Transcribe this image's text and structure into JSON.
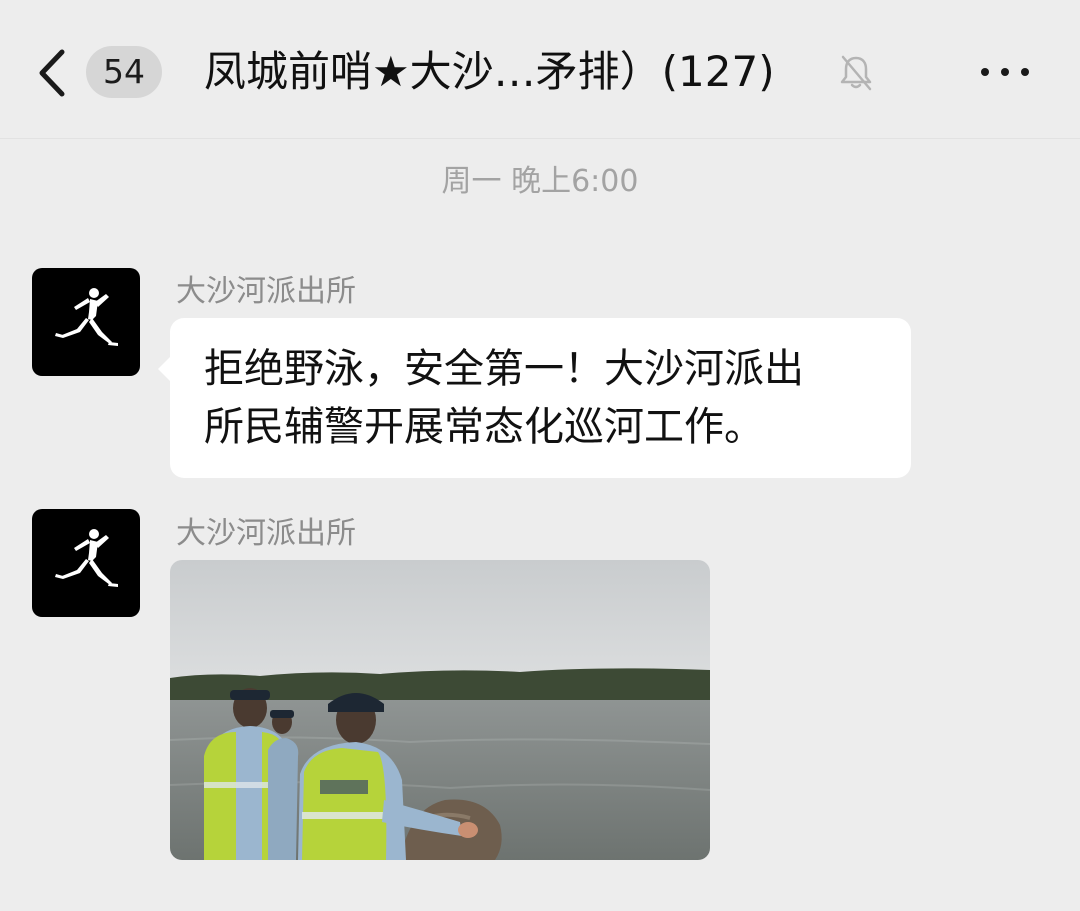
{
  "header": {
    "back_icon": "chevron-left-icon",
    "unread_count": "54",
    "title": "凤城前哨★大沙…矛排）(127)",
    "mute_icon": "bell-muted-icon",
    "more_icon": "ellipsis-icon"
  },
  "timestamp": "周一 晚上6:00",
  "messages": [
    {
      "type": "text",
      "sender": "大沙河派出所",
      "avatar_icon": "jumpman-logo-icon",
      "line1": "拒绝野泳，安全第一！大沙河派出",
      "line2": "所民辅警开展常态化巡河工作。"
    },
    {
      "type": "image",
      "sender": "大沙河派出所",
      "avatar_icon": "jumpman-logo-icon",
      "image_subject": "police-officers-patrolling-river-photo"
    }
  ],
  "colors": {
    "background": "#ededed",
    "bubble": "#ffffff",
    "avatar_bg": "#000000",
    "muted_text": "#a3a3a3",
    "name_text": "#8c8c8c"
  }
}
